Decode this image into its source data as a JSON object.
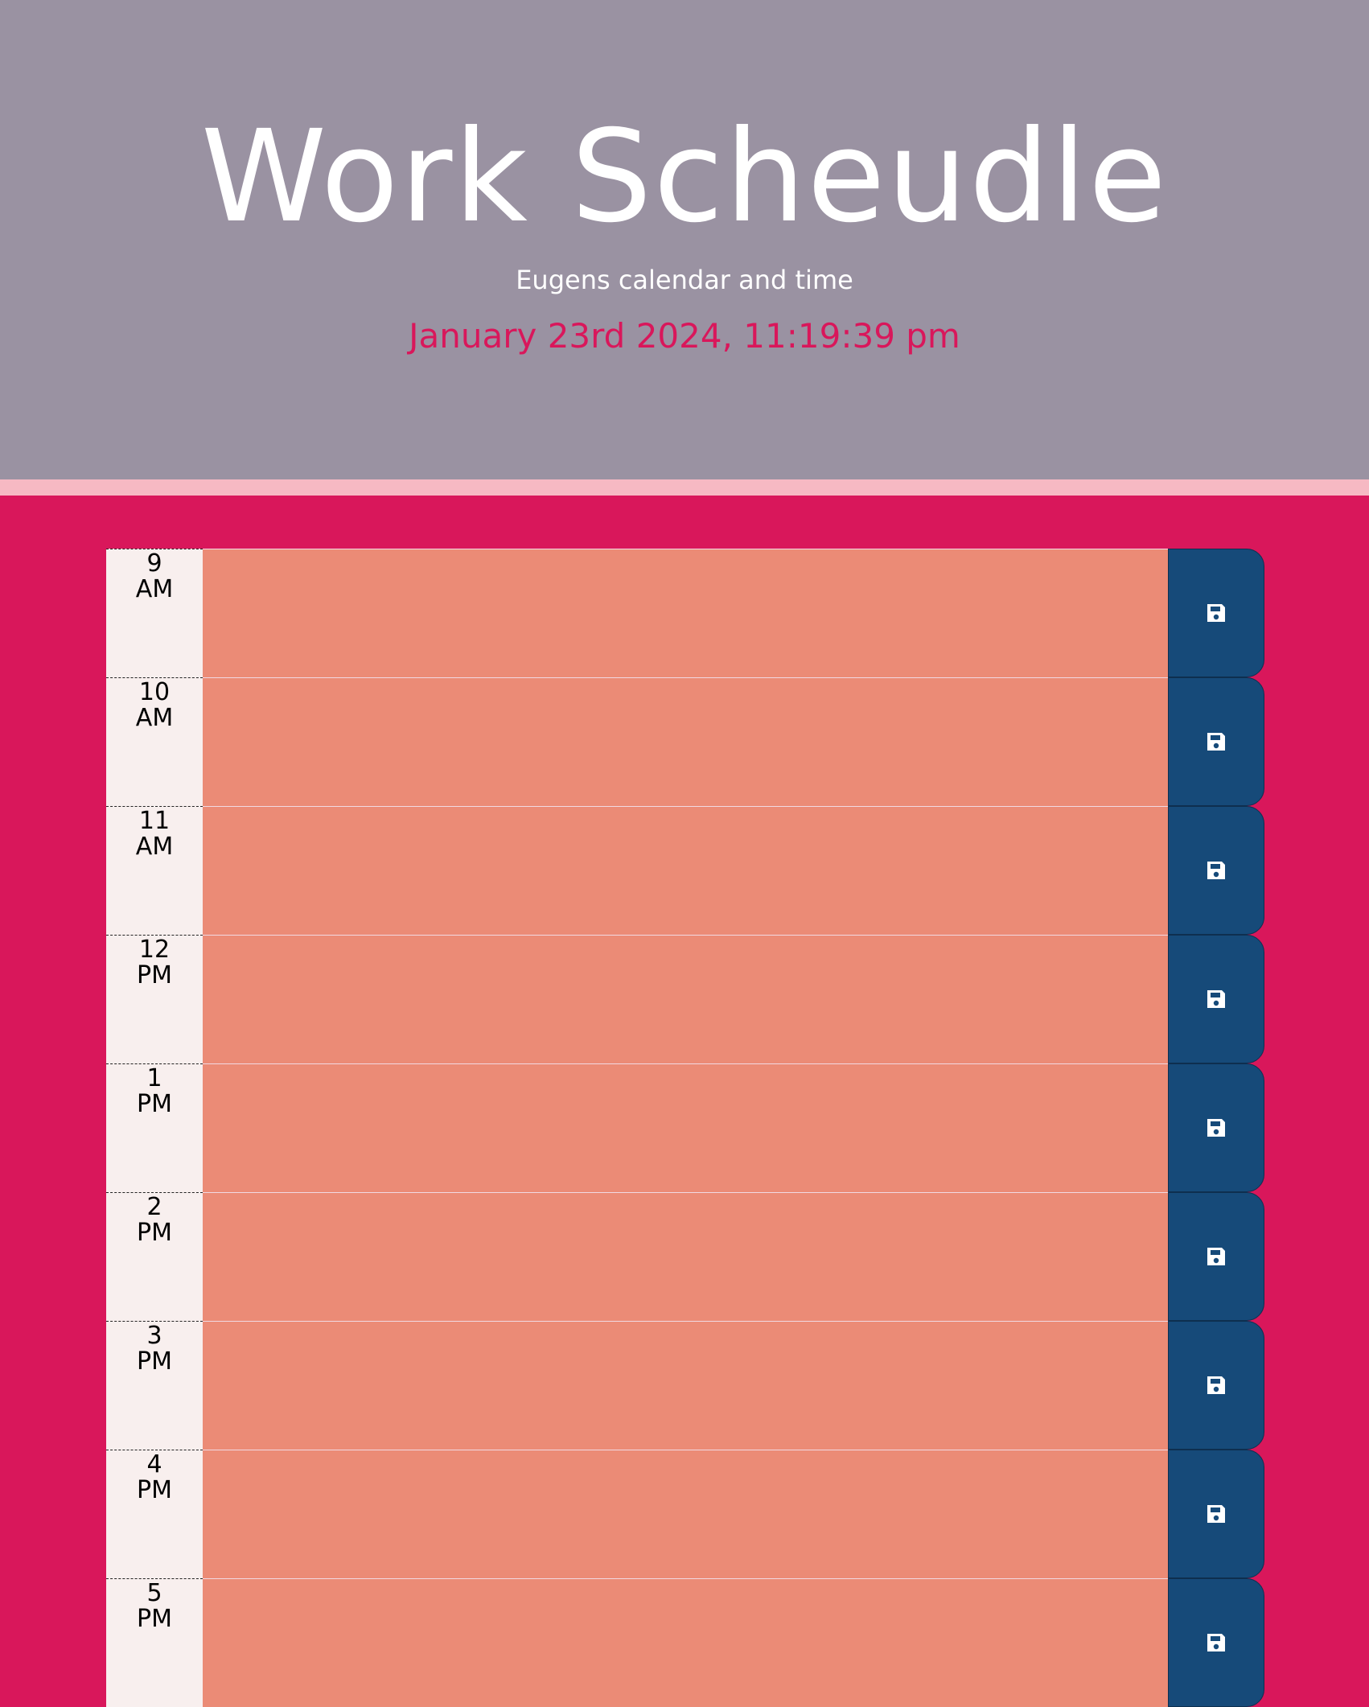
{
  "header": {
    "title": "Work Scheudle",
    "subtitle": "Eugens calendar and time",
    "datetime": "January 23rd 2024, 11:19:39 pm"
  },
  "schedule": {
    "save_icon": "floppy-disk-icon",
    "rows": [
      {
        "hour": "9",
        "period": "AM",
        "text": ""
      },
      {
        "hour": "10",
        "period": "AM",
        "text": ""
      },
      {
        "hour": "11",
        "period": "AM",
        "text": ""
      },
      {
        "hour": "12",
        "period": "PM",
        "text": ""
      },
      {
        "hour": "1",
        "period": "PM",
        "text": ""
      },
      {
        "hour": "2",
        "period": "PM",
        "text": ""
      },
      {
        "hour": "3",
        "period": "PM",
        "text": ""
      },
      {
        "hour": "4",
        "period": "PM",
        "text": ""
      },
      {
        "hour": "5",
        "period": "PM",
        "text": ""
      }
    ]
  },
  "colors": {
    "header_bg": "#9a92a2",
    "page_bg": "#d9175b",
    "row_bg": "#eb8b76",
    "save_button": "#164a79"
  }
}
